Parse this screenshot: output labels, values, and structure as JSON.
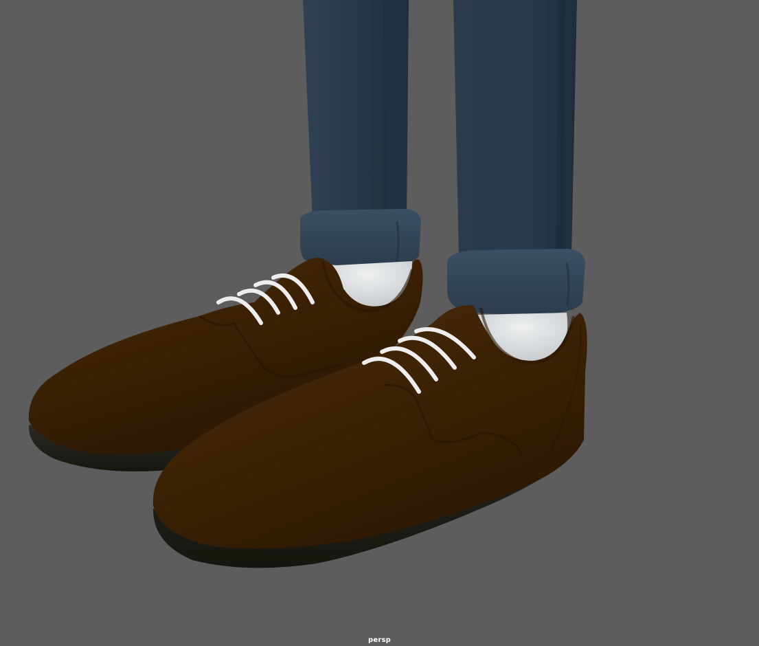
{
  "viewport": {
    "camera_label": "persp",
    "background_color": "#5d5d5d"
  },
  "scene": {
    "objects": [
      {
        "name": "left-pant-leg",
        "color": "#2b3a4a"
      },
      {
        "name": "right-pant-leg",
        "color": "#2b3a4a"
      },
      {
        "name": "left-sock",
        "color": "#d9dcde"
      },
      {
        "name": "right-sock",
        "color": "#d9dcde"
      },
      {
        "name": "left-shoe",
        "color": "#3a2005"
      },
      {
        "name": "right-shoe",
        "color": "#3a2005"
      },
      {
        "name": "shoe-soles",
        "color": "#1e1e1a"
      },
      {
        "name": "shoelaces",
        "color": "#e8e8e8"
      }
    ]
  }
}
